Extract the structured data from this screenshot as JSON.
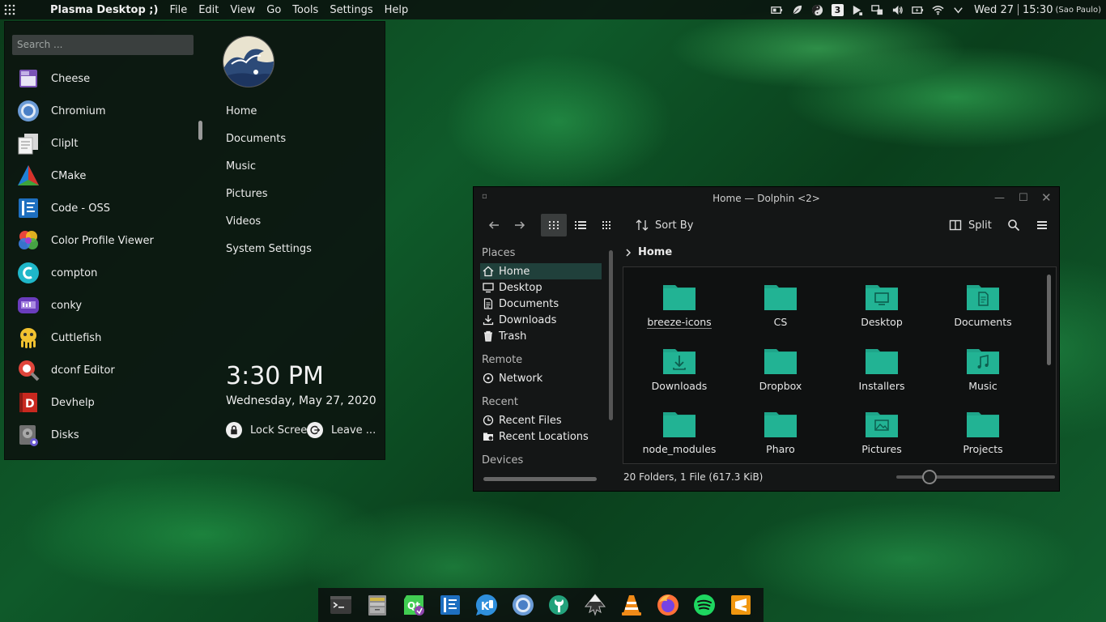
{
  "panel": {
    "app_name": "Plasma Desktop ;)",
    "menus": [
      "File",
      "Edit",
      "View",
      "Go",
      "Tools",
      "Settings",
      "Help"
    ],
    "tray_icons": [
      "battery-icon",
      "leaf-icon",
      "yin-yang-icon",
      "badge-3-icon",
      "play-icon",
      "display-icon",
      "volume-icon",
      "battery-charge-icon",
      "wifi-icon",
      "chevron-down-icon"
    ],
    "tray_badge": "3",
    "clock_date": "Wed 27",
    "clock_time": "15:30",
    "timezone": "(Sao Paulo)"
  },
  "launcher": {
    "search_placeholder": "Search ...",
    "apps": [
      "Cheese",
      "Chromium",
      "ClipIt",
      "CMake",
      "Code - OSS",
      "Color Profile Viewer",
      "compton",
      "conky",
      "Cuttlefish",
      "dconf Editor",
      "Devhelp",
      "Disks"
    ],
    "places": [
      "Home",
      "Documents",
      "Music",
      "Pictures",
      "Videos",
      "System Settings"
    ],
    "time": "3:30 PM",
    "date": "Wednesday, May 27, 2020",
    "lock_label": "Lock Screen",
    "leave_label": "Leave ..."
  },
  "dolphin": {
    "title": "Home — Dolphin <2>",
    "sort_label": "Sort By",
    "split_label": "Split",
    "sections": {
      "places": "Places",
      "remote": "Remote",
      "recent": "Recent",
      "devices": "Devices"
    },
    "places_items": [
      "Home",
      "Desktop",
      "Documents",
      "Downloads",
      "Trash"
    ],
    "remote_items": [
      "Network"
    ],
    "recent_items": [
      "Recent Files",
      "Recent Locations"
    ],
    "breadcrumb": "Home",
    "folders": [
      "breeze-icons",
      "CS",
      "Desktop",
      "Documents",
      "Downloads",
      "Dropbox",
      "Installers",
      "Music",
      "node_modules",
      "Pharo",
      "Pictures",
      "Projects"
    ],
    "status": "20 Folders, 1 File (617.3 KiB)"
  },
  "dock": {
    "icons": [
      "terminal-icon",
      "file-manager-icon",
      "qt-creator-icon",
      "code-oss-icon",
      "kde-connect-icon",
      "chromium-icon",
      "settings-wrench-icon",
      "inkscape-icon",
      "vlc-icon",
      "firefox-icon",
      "spotify-icon",
      "sublime-icon"
    ]
  },
  "colors": {
    "folder": "#1fa58a",
    "selection": "#20403b",
    "panel": "#0a0c0c"
  }
}
